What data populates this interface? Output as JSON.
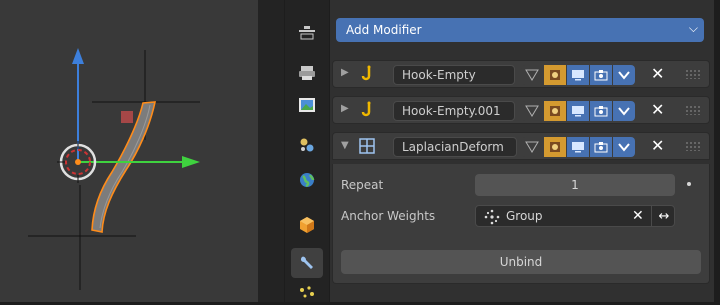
{
  "viewport": {
    "colors": {
      "x_axis": "#3fd23f",
      "z_axis": "#3d7fdb",
      "selection": "#ff8c1a",
      "mesh": "#808080",
      "cursor": "#cc3333"
    }
  },
  "tabs": [
    {
      "name": "view-layer-tab",
      "icon": "view-layer-icon"
    },
    {
      "name": "output-tab",
      "icon": "printer-icon"
    },
    {
      "name": "image-tab",
      "icon": "image-icon"
    },
    {
      "name": "scene-tab",
      "icon": "scene-icon"
    },
    {
      "name": "world-tab",
      "icon": "world-icon"
    },
    {
      "name": "object-tab",
      "icon": "cube-icon"
    },
    {
      "name": "modifier-tab",
      "icon": "wrench-icon",
      "active": true
    },
    {
      "name": "particles-tab",
      "icon": "particles-icon"
    }
  ],
  "add_modifier": {
    "label": "Add Modifier",
    "accent": "#4772b3"
  },
  "modifiers": [
    {
      "name": "Hook-Empty",
      "type_icon": "hook-icon",
      "expanded": false
    },
    {
      "name": "Hook-Empty.001",
      "type_icon": "hook-icon",
      "expanded": false
    },
    {
      "name": "LaplacianDeform",
      "type_icon": "lattice-icon",
      "expanded": true
    }
  ],
  "laplacian": {
    "repeat_label": "Repeat",
    "repeat_value": "1",
    "anchor_label": "Anchor Weights",
    "anchor_value": "Group",
    "unbind_label": "Unbind"
  }
}
